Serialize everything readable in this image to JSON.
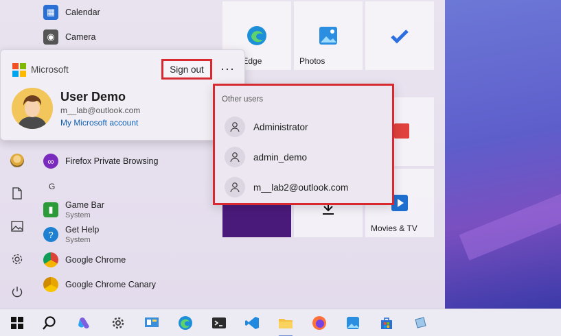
{
  "account": {
    "brand": "Microsoft",
    "sign_out": "Sign out",
    "more": "···",
    "user_name": "User Demo",
    "user_email": "m__lab@outlook.com",
    "account_link": "My Microsoft account"
  },
  "other_users": {
    "title": "Other users",
    "users": [
      "Administrator",
      "admin_demo",
      "m__lab2@outlook.com"
    ]
  },
  "apps": {
    "calendar": "Calendar",
    "camera": "Camera",
    "firefox_private": "Firefox Private Browsing",
    "letter_g": "G",
    "game_bar": "Game Bar",
    "game_bar_sub": "System",
    "get_help": "Get Help",
    "get_help_sub": "System",
    "chrome": "Google Chrome",
    "chrome_canary": "Google Chrome Canary"
  },
  "tiles": {
    "edge": "osoft Edge",
    "photos": "Photos",
    "movies": "Movies & TV"
  },
  "taskbar": {
    "icons": [
      "windows-start-icon",
      "search-icon",
      "copilot-icon",
      "settings-icon",
      "control-panel-icon",
      "edge-icon",
      "terminal-icon",
      "vscode-icon",
      "file-explorer-icon",
      "firefox-icon",
      "photos-icon",
      "store-icon",
      "notepad-icon"
    ]
  },
  "colors": {
    "highlight": "#d7292f",
    "link": "#0a5fb4"
  }
}
